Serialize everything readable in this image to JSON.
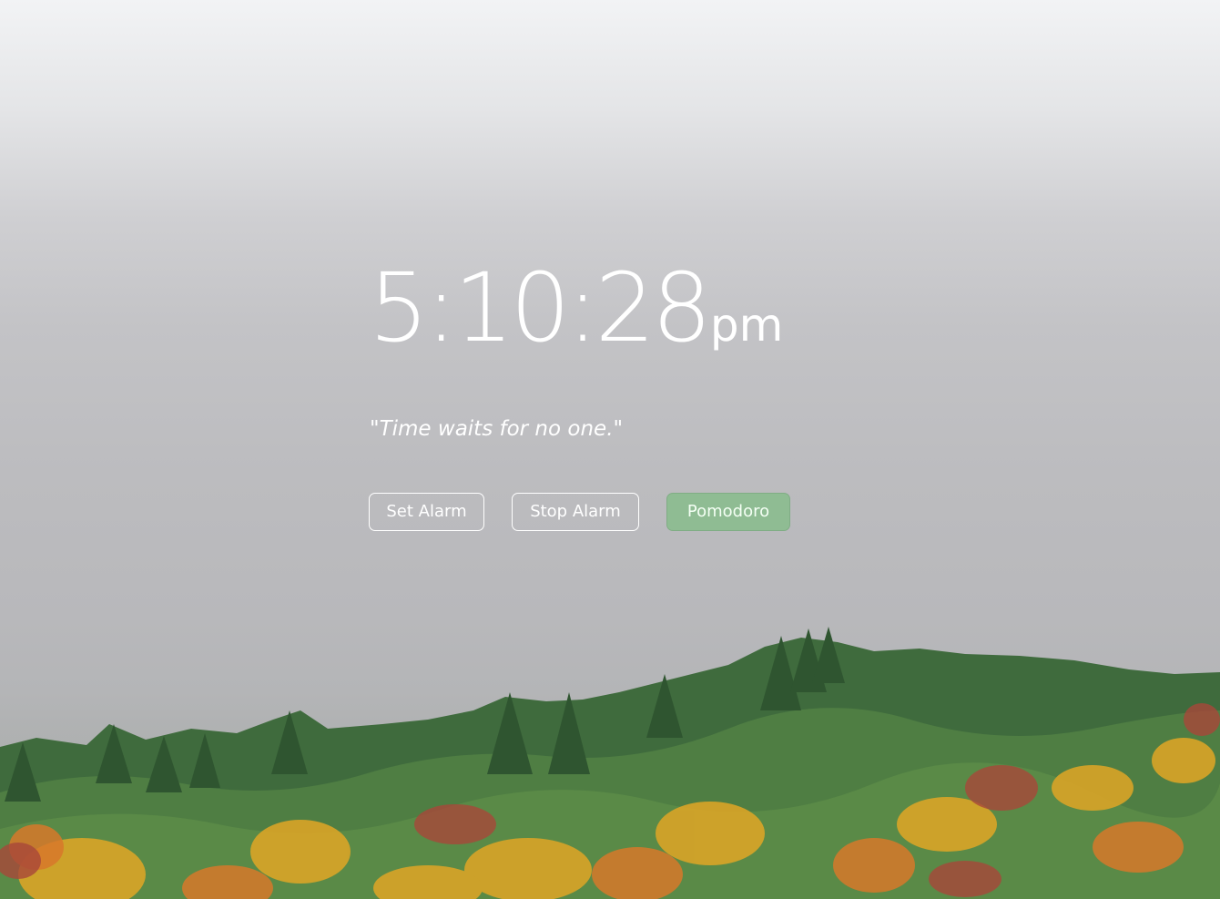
{
  "clock": {
    "time": "5:10:28",
    "ampm": "pm"
  },
  "quote": "\"Time waits for no one.\"",
  "buttons": {
    "set_alarm": "Set Alarm",
    "stop_alarm": "Stop Alarm",
    "pomodoro": "Pomodoro"
  },
  "colors": {
    "pomodoro_bg": "#8fbc93",
    "text": "#ffffff",
    "sky": "#bcbcbf"
  },
  "background": {
    "scene": "foggy-autumn-forest-hillside"
  }
}
